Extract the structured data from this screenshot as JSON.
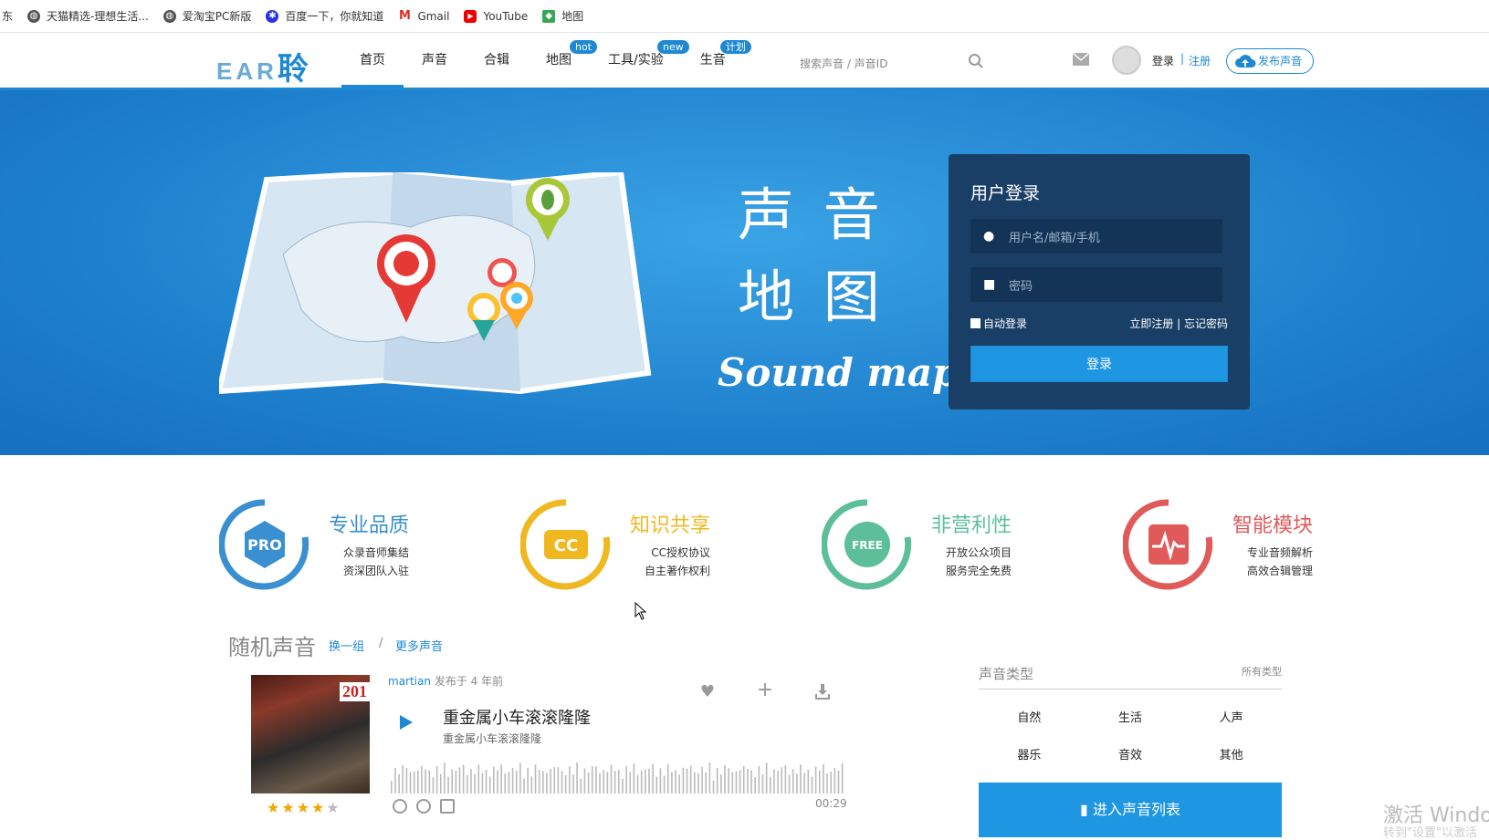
{
  "bookmarks": [
    {
      "label": "东",
      "icon": "none"
    },
    {
      "label": "天猫精选-理想生活...",
      "icon": "globe-icon"
    },
    {
      "label": "爱淘宝PC新版",
      "icon": "globe-icon"
    },
    {
      "label": "百度一下，你就知道",
      "icon": "baidu-paw-icon"
    },
    {
      "label": "Gmail",
      "icon": "gmail-icon"
    },
    {
      "label": "YouTube",
      "icon": "youtube-icon"
    },
    {
      "label": "地图",
      "icon": "maps-icon"
    }
  ],
  "nav": {
    "logo_text": "EAR",
    "logo_char": "聆",
    "menu": [
      {
        "label": "首页",
        "badge": "",
        "active": true
      },
      {
        "label": "声音",
        "badge": ""
      },
      {
        "label": "合辑",
        "badge": ""
      },
      {
        "label": "地图",
        "badge": "hot"
      },
      {
        "label": "工具/实验",
        "badge": "new"
      },
      {
        "label": "生音",
        "badge": "计划"
      }
    ],
    "search_placeholder": "搜索声音 / 声音ID",
    "login": "登录",
    "separator": "|",
    "register": "注册",
    "publish": "发布声音"
  },
  "hero": {
    "title_lines": [
      "声 音",
      "地 图"
    ],
    "subtitle": "Sound map",
    "login_panel": {
      "title": "用户登录",
      "username_placeholder": "用户名/邮箱/手机",
      "password_placeholder": "密码",
      "remember": "自动登录",
      "links": "立即注册 | 忘记密码",
      "submit": "登录"
    },
    "slides": 4,
    "active_slide": 1
  },
  "features": [
    {
      "title": "专业品质",
      "badge": "PRO",
      "lines": [
        "众录音师集结",
        "资深团队入驻"
      ],
      "color": "#3a8fd0"
    },
    {
      "title": "知识共享",
      "badge": "CC",
      "lines": [
        "CC授权协议",
        "自主著作权利"
      ],
      "color": "#f0b820"
    },
    {
      "title": "非营利性",
      "badge": "FREE",
      "lines": [
        "开放公众项目",
        "服务完全免费"
      ],
      "color": "#5dbf9a"
    },
    {
      "title": "智能模块",
      "badge": "pulse",
      "lines": [
        "专业音频解析",
        "高效合辑管理"
      ],
      "color": "#e05a5a"
    }
  ],
  "random": {
    "title": "随机声音",
    "swap": "换一组",
    "slash": "/",
    "more": "更多声音",
    "item": {
      "user": "martian",
      "posted": "发布于 4 年前",
      "title": "重金属小车滚滚隆隆",
      "subtitle": "重金属小车滚滚隆隆",
      "cover_label": "201",
      "rating": 4,
      "rating_max": 5,
      "duration": "00:29"
    }
  },
  "types": {
    "title": "声音类型",
    "all": "所有类型",
    "items": [
      "自然",
      "生活",
      "人声",
      "器乐",
      "音效",
      "其他"
    ],
    "enter": "进入声音列表"
  },
  "watermark": {
    "line1": "激活 Windo",
    "line2": "转到\"设置\"以激活"
  }
}
